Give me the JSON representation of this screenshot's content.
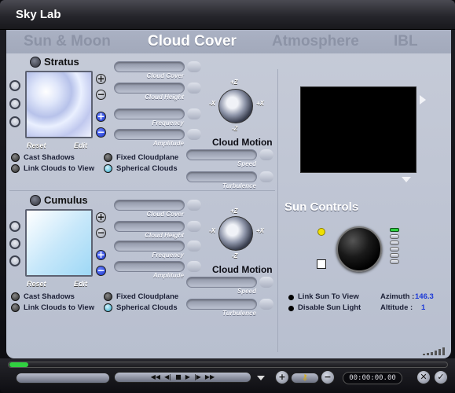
{
  "window": {
    "title": "Sky Lab"
  },
  "tabs": [
    {
      "label": "Sun & Moon"
    },
    {
      "label": "Cloud Cover"
    },
    {
      "label": "Atmosphere"
    },
    {
      "label": "IBL"
    }
  ],
  "stratus": {
    "title": "Stratus",
    "reset": "Reset",
    "edit": "Edit",
    "sliders": [
      "Cloud Cover",
      "Cloud Height",
      "Frequency",
      "Amplitude"
    ],
    "options_left": [
      "Cast Shadows",
      "Link Clouds to View"
    ],
    "options_right": [
      "Fixed Cloudplane",
      "Spherical Clouds"
    ],
    "motion_title": "Cloud Motion",
    "motion_sliders": [
      "Speed",
      "Turbulence"
    ],
    "axes": {
      "up": "+Z",
      "down": "-Z",
      "left": "-X",
      "right": "+X"
    }
  },
  "cumulus": {
    "title": "Cumulus",
    "reset": "Reset",
    "edit": "Edit",
    "sliders": [
      "Cloud Cover",
      "Cloud Height",
      "Frequency",
      "Amplitude"
    ],
    "options_left": [
      "Cast Shadows",
      "Link Clouds to View"
    ],
    "options_right": [
      "Fixed Cloudplane",
      "Spherical Clouds"
    ],
    "motion_title": "Cloud Motion",
    "motion_sliders": [
      "Speed",
      "Turbulence"
    ],
    "axes": {
      "up": "+Z",
      "down": "-Z",
      "left": "-X",
      "right": "+X"
    }
  },
  "sun": {
    "title": "Sun Controls",
    "link_label": "Link Sun To View",
    "disable_label": "Disable Sun Light",
    "azimuth_label": "Azimuth :",
    "azimuth_value": "146.3",
    "altitude_label": "Altitude :",
    "altitude_value": "1"
  },
  "timeline": {
    "time": "00:00:00.00"
  },
  "colors": {
    "accent": "#1430c8",
    "sun_indicator": "#f0e000",
    "timeline_green": "#30d040"
  }
}
